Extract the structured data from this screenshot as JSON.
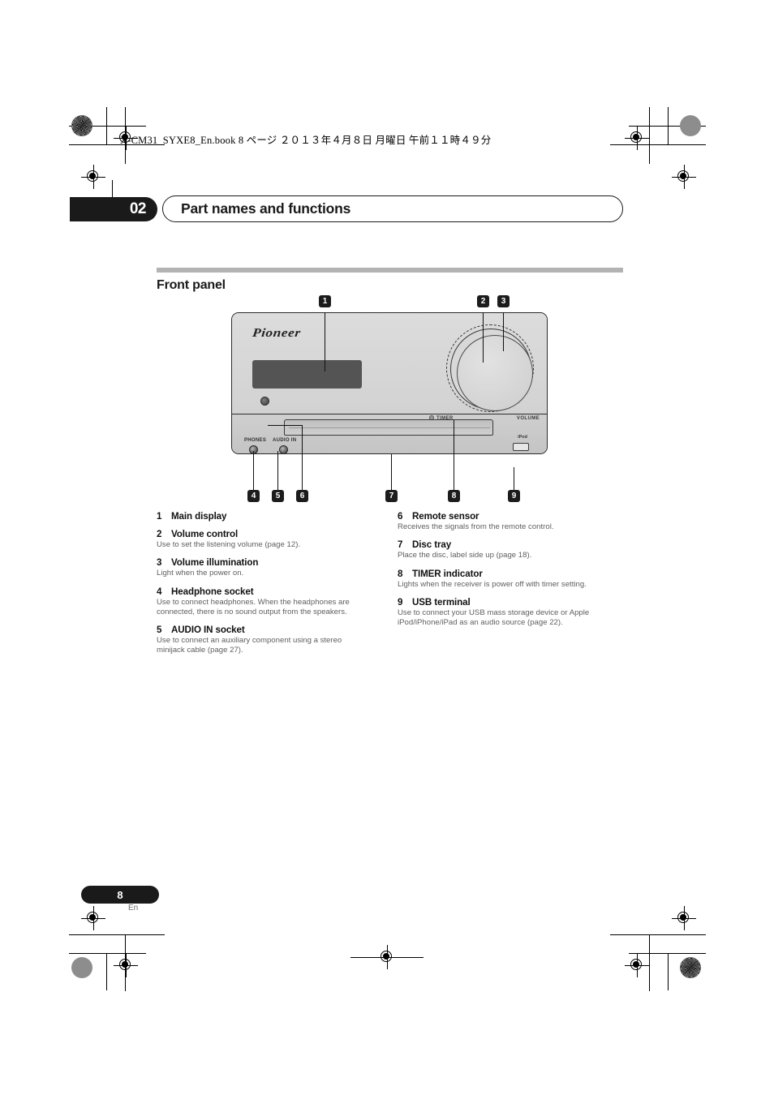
{
  "print_header": {
    "file_line": "X-CM31_SYXE8_En.book   8 ページ   ２０１３年４月８日   月曜日   午前１１時４９分"
  },
  "chapter": {
    "number": "02",
    "title": "Part names and functions"
  },
  "section": {
    "title": "Front panel"
  },
  "device": {
    "brand_logo": "Pioneer",
    "labels": {
      "volume": "VOLUME",
      "timer": "TIMER",
      "phones": "PHONES",
      "audio_in": "AUDIO IN",
      "ipod": "iPod"
    },
    "callouts": [
      "1",
      "2",
      "3",
      "4",
      "5",
      "6",
      "7",
      "8",
      "9"
    ]
  },
  "items_left": [
    {
      "num": "1",
      "title": "Main display",
      "desc": ""
    },
    {
      "num": "2",
      "title": "Volume control",
      "desc": "Use to set the listening volume (page 12)."
    },
    {
      "num": "3",
      "title": "Volume illumination",
      "desc": "Light when the power on."
    },
    {
      "num": "4",
      "title": "Headphone socket",
      "desc": "Use to connect headphones. When the headphones are connected, there is no sound output from the speakers."
    },
    {
      "num": "5",
      "title": "AUDIO IN socket",
      "desc": "Use to connect an auxiliary component using a stereo minijack cable (page 27)."
    }
  ],
  "items_right": [
    {
      "num": "6",
      "title": "Remote sensor",
      "desc": "Receives the signals from the remote control."
    },
    {
      "num": "7",
      "title": "Disc tray",
      "desc": "Place the disc, label side up (page 18)."
    },
    {
      "num": "8",
      "title": "TIMER indicator",
      "desc": "Lights when the receiver is power off with timer setting."
    },
    {
      "num": "9",
      "title": "USB terminal",
      "desc": "Use to connect your USB mass storage device or Apple iPod/iPhone/iPad as an audio source (page 22)."
    }
  ],
  "footer": {
    "page_number": "8",
    "language": "En"
  },
  "colors": {
    "chapter_tab_bg": "#1a1a1a",
    "section_rule": "#b3b3b3",
    "display_panel": "#545454",
    "device_body": "#d4d4d4",
    "desc_text": "#5f5f5f"
  }
}
